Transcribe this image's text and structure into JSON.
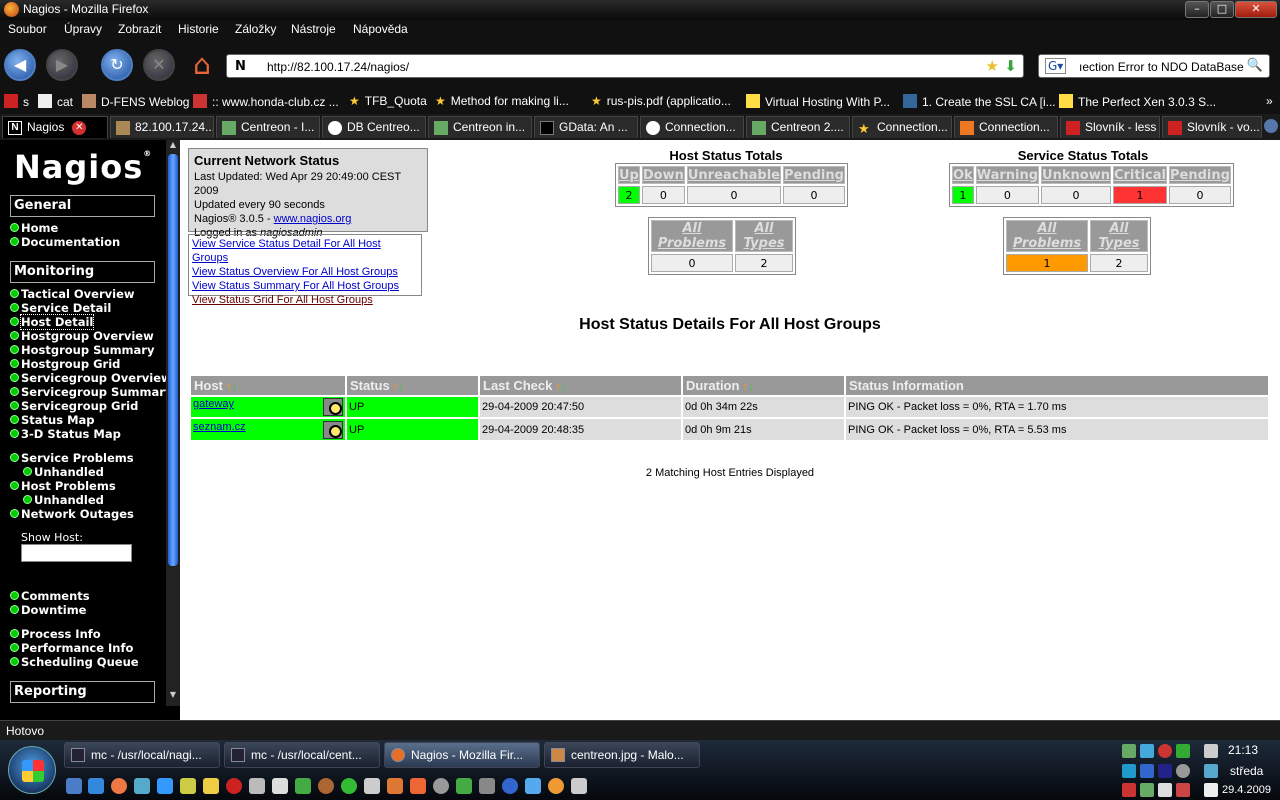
{
  "window": {
    "title": "Nagios - Mozilla Firefox"
  },
  "menu": [
    "Soubor",
    "Úpravy",
    "Zobrazit",
    "Historie",
    "Záložky",
    "Nástroje",
    "Nápověda"
  ],
  "address": {
    "url": "http://82.100.17.24/nagios/"
  },
  "search": {
    "query": "ıection Error to NDO DataBase !"
  },
  "bookmarks": [
    "s",
    "cat",
    "D-FENS Weblog",
    ":: www.honda-club.cz ...",
    "TFB_Quota",
    "Method for making li...",
    "rus-pis.pdf (applicatio...",
    "Virtual Hosting With P...",
    "1. Create the SSL CA [i...",
    "The Perfect Xen 3.0.3 S..."
  ],
  "tabs": [
    "Nagios",
    "82.100.17.24...",
    "Centreon - I...",
    "DB Centreo...",
    "Centreon in...",
    "GData: An ...",
    "Connection...",
    "Centreon 2....",
    "Connection...",
    "Connection...",
    "Slovník - less",
    "Slovník - vo..."
  ],
  "sidebar": {
    "logo": "Nagios",
    "sections": {
      "general": "General",
      "monitoring": "Monitoring",
      "reporting": "Reporting"
    },
    "general_items": [
      "Home",
      "Documentation"
    ],
    "monitoring_items": [
      "Tactical Overview",
      "Service Detail",
      "Host Detail",
      "Hostgroup Overview",
      "Hostgroup Summary",
      "Hostgroup Grid",
      "Servicegroup Overview",
      "Servicegroup Summary",
      "Servicegroup Grid",
      "Status Map",
      "3-D Status Map"
    ],
    "problems": [
      "Service Problems",
      "Unhandled",
      "Host Problems",
      "Unhandled",
      "Network Outages"
    ],
    "show_host_label": "Show Host:",
    "misc_items": [
      "Comments",
      "Downtime"
    ],
    "process_items": [
      "Process Info",
      "Performance Info",
      "Scheduling Queue"
    ]
  },
  "network_status": {
    "title": "Current Network Status",
    "last_updated": "Last Updated: Wed Apr 29 20:49:00 CEST 2009",
    "updated_every": "Updated every 90 seconds",
    "version_prefix": "Nagios® 3.0.5 - ",
    "version_link": "www.nagios.org",
    "logged_in_prefix": "Logged in as ",
    "user": "nagiosadmin"
  },
  "view_links": [
    "View Service Status Detail For All Host Groups",
    "View Status Overview For All Host Groups",
    "View Status Summary For All Host Groups",
    "View Status Grid For All Host Groups"
  ],
  "host_totals": {
    "title": "Host Status Totals",
    "headers": [
      "Up",
      "Down",
      "Unreachable",
      "Pending"
    ],
    "values": [
      "2",
      "0",
      "0",
      "0"
    ],
    "summary_headers": [
      "All Problems",
      "All Types"
    ],
    "summary_values": [
      "0",
      "2"
    ]
  },
  "service_totals": {
    "title": "Service Status Totals",
    "headers": [
      "Ok",
      "Warning",
      "Unknown",
      "Critical",
      "Pending"
    ],
    "values": [
      "1",
      "0",
      "0",
      "1",
      "0"
    ],
    "summary_headers": [
      "All Problems",
      "All Types"
    ],
    "summary_values": [
      "1",
      "2"
    ]
  },
  "page_title": "Host Status Details For All Host Groups",
  "host_table": {
    "columns": [
      "Host",
      "Status",
      "Last Check",
      "Duration",
      "Status Information"
    ],
    "rows": [
      {
        "host": "gateway",
        "status": "UP",
        "last_check": "29-04-2009 20:47:50",
        "duration": "0d 0h 34m 22s",
        "info": "PING OK - Packet loss = 0%, RTA = 1.70 ms"
      },
      {
        "host": "seznam.cz",
        "status": "UP",
        "last_check": "29-04-2009 20:48:35",
        "duration": "0d 0h 9m 21s",
        "info": "PING OK - Packet loss = 0%, RTA = 5.53 ms"
      }
    ]
  },
  "matching": "2 Matching Host Entries Displayed",
  "statusbar": "Hotovo",
  "taskbar": {
    "buttons": [
      "mc - /usr/local/nagi...",
      "mc - /usr/local/cent...",
      "Nagios - Mozilla Fir...",
      "centreon.jpg - Malo..."
    ],
    "clock": "21:13",
    "day": "středa",
    "date": "29.4.2009"
  },
  "colors": {
    "up": "#00ff00",
    "critical": "#ff3333",
    "problems": "#ff9900",
    "header_grey": "#999999"
  }
}
